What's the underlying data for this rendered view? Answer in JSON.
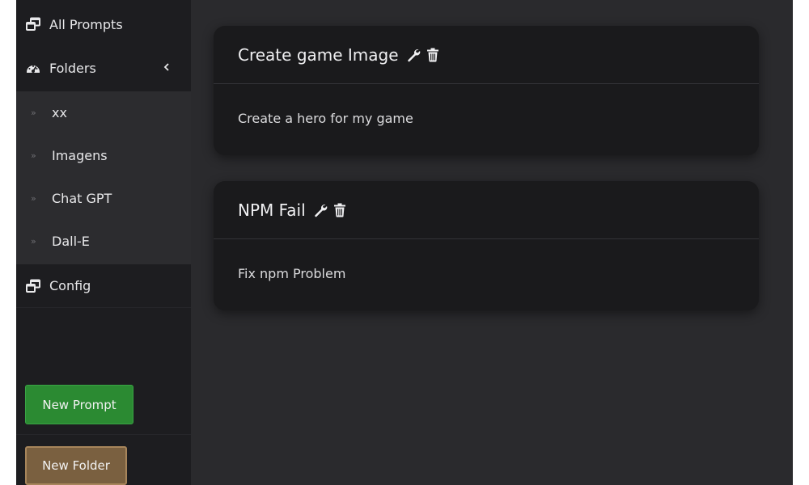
{
  "sidebar": {
    "all_prompts": "All Prompts",
    "folders": "Folders",
    "folder_items": [
      "xx",
      "Imagens",
      "Chat GPT",
      "Dall-E"
    ],
    "config": "Config",
    "new_prompt": "New Prompt",
    "new_folder": "New Folder"
  },
  "prompts": [
    {
      "title": "Create game Image",
      "text": "Create a hero for my game"
    },
    {
      "title": "NPM Fail",
      "text": "Fix npm Problem"
    }
  ],
  "colors": {
    "app_bg": "#2a2a2d",
    "sidebar_bg": "#1d1d20",
    "card_bg": "#1a1a1c",
    "new_prompt_green": "#2b8a32",
    "new_folder_brown": "#7a6040"
  },
  "icons": {
    "all_prompts": "windows-icon",
    "folders": "dashboard-gauge-icon",
    "folders_toggle": "chevron-left-icon",
    "folder_item": "double-chevron-right-icon",
    "config": "windows-icon",
    "edit": "wrench-icon",
    "delete": "trash-icon"
  }
}
